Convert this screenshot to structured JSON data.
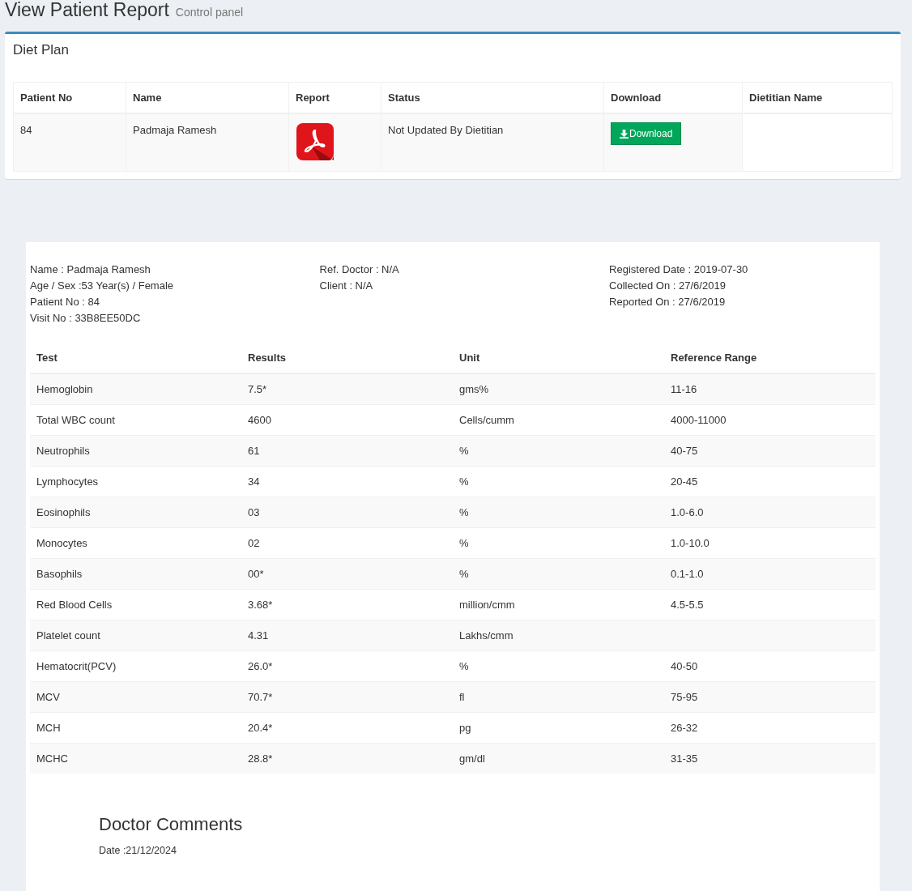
{
  "page_header": {
    "title": "View Patient Report",
    "subtitle": "Control panel"
  },
  "diet_plan": {
    "title": "Diet Plan",
    "columns": [
      "Patient No",
      "Name",
      "Report",
      "Status",
      "Download",
      "Dietitian Name"
    ],
    "rows": [
      {
        "patient_no": "84",
        "name": "Padmaja Ramesh",
        "status": "Not Updated By Dietitian",
        "download_button": "Download"
      }
    ]
  },
  "report": {
    "info_columns": [
      [
        "Name : Padmaja Ramesh",
        "Age / Sex :53 Year(s) / Female",
        "Patient No : 84",
        "Visit No : 33B8EE50DC"
      ],
      [
        "Ref. Doctor : N/A",
        "Client : N/A"
      ],
      [
        "Registered Date : 2019-07-30",
        "Collected On : 27/6/2019",
        "Reported On : 27/6/2019"
      ]
    ],
    "columns": [
      "Test",
      "Results",
      "Unit",
      "Reference Range"
    ],
    "rows": [
      {
        "test": "Hemoglobin",
        "result": "7.5*",
        "unit": "gms%",
        "range": "11-16"
      },
      {
        "test": "Total WBC count",
        "result": "4600",
        "unit": "Cells/cumm",
        "range": "4000-11000"
      },
      {
        "test": "Neutrophils",
        "result": "61",
        "unit": "%",
        "range": "40-75"
      },
      {
        "test": "Lymphocytes",
        "result": "34",
        "unit": "%",
        "range": "20-45"
      },
      {
        "test": "Eosinophils",
        "result": "03",
        "unit": "%",
        "range": "1.0-6.0"
      },
      {
        "test": "Monocytes",
        "result": "02",
        "unit": "%",
        "range": "1.0-10.0"
      },
      {
        "test": "Basophils",
        "result": "00*",
        "unit": "%",
        "range": "0.1-1.0"
      },
      {
        "test": "Red Blood Cells",
        "result": "3.68*",
        "unit": "million/cmm",
        "range": "4.5-5.5"
      },
      {
        "test": "Platelet count",
        "result": "4.31",
        "unit": "Lakhs/cmm"
      },
      {
        "test": "Hematocrit(PCV)",
        "result": "26.0*",
        "unit": "%",
        "range": "40-50"
      },
      {
        "test": "MCV",
        "result": "70.7*",
        "unit": "fl",
        "range": "75-95"
      },
      {
        "test": "MCH",
        "result": "20.4*",
        "unit": "pg",
        "range": "26-32"
      },
      {
        "test": "MCHC",
        "result": "28.8*",
        "unit": "gm/dl",
        "range": "31-35"
      }
    ],
    "comments": {
      "title": "Doctor Comments",
      "date": "Date :21/12/2024"
    }
  }
}
